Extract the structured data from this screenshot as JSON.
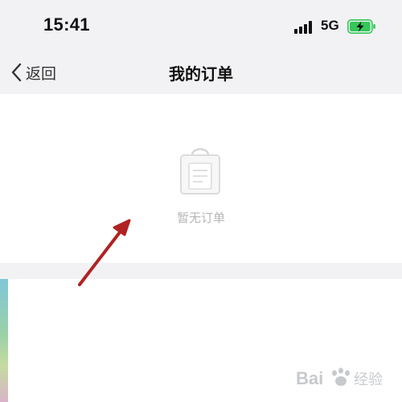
{
  "status_bar": {
    "time": "15:41",
    "network": "5G",
    "battery_color": "#34c759"
  },
  "nav": {
    "back_label": "返回",
    "title": "我的订单"
  },
  "empty_state": {
    "message": "暂无订单",
    "icon": "shopping-bag-icon"
  },
  "annotation": {
    "arrow_color": "#b02222"
  },
  "watermark": {
    "text": "Bai 经验"
  }
}
